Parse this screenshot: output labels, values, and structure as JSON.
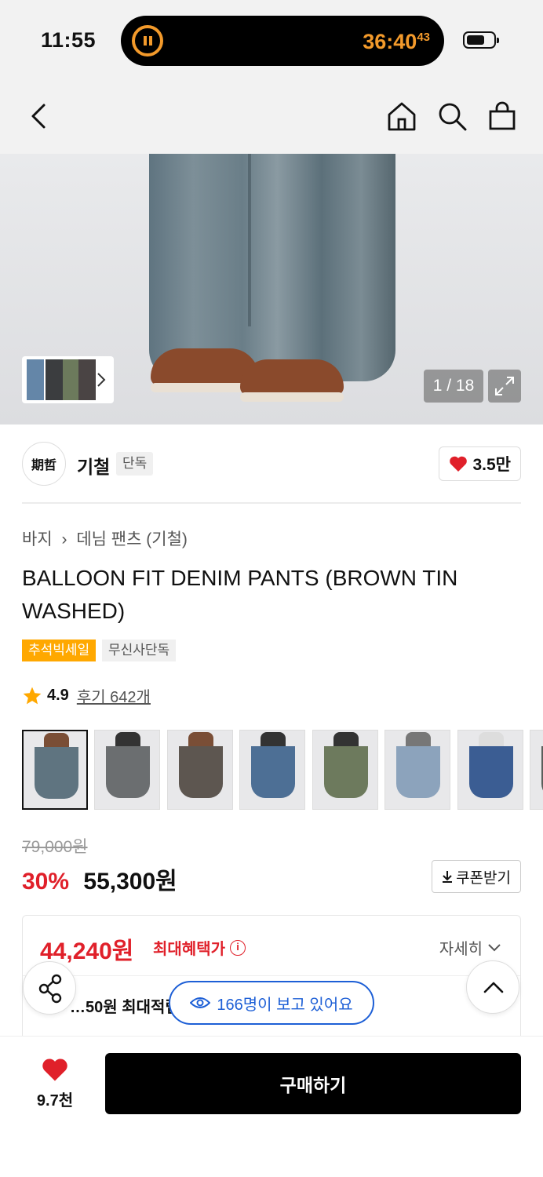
{
  "status_bar": {
    "time": "11:55",
    "timer": "36:40",
    "timer_sup": "43"
  },
  "nav": {
    "back_icon": "chevron-left-icon",
    "home_icon": "home-icon",
    "search_icon": "search-icon",
    "cart_icon": "shopping-bag-icon"
  },
  "gallery": {
    "counter": "1 / 18",
    "expand_icon": "expand-icon"
  },
  "brand": {
    "name": "기철",
    "tag": "단독",
    "logo_text": "期哲",
    "likes": "3.5만"
  },
  "breadcrumb": [
    "바지",
    "데님 팬츠 (기철)"
  ],
  "product": {
    "title": "BALLOON FIT DENIM PANTS (BROWN TIN WASHED)",
    "badges": [
      "추석빅세일",
      "무신사단독"
    ],
    "rating": "4.9",
    "review_label": "후기 642개"
  },
  "colors": {
    "swatches": [
      "#5f7480",
      "#6b6e70",
      "#5d5650",
      "#4d6f95",
      "#6d7a5d",
      "#8ca3bc",
      "#3b5d93",
      "#5a5e5b"
    ],
    "sale_badge": "#ffa800",
    "price_red": "#e0202a",
    "viewers_blue": "#1d5fd6"
  },
  "price": {
    "original": "79,000원",
    "discount": "30%",
    "sale": "55,300원",
    "coupon_label": "쿠폰받기"
  },
  "benefit": {
    "max_price": "44,240원",
    "max_label": "최대혜택가",
    "detail_label": "자세히",
    "points": "…50원 최대적립"
  },
  "floating": {
    "viewers": "166명이 보고 있어요"
  },
  "bottom": {
    "wish_count": "9.7천",
    "buy_label": "구매하기"
  }
}
